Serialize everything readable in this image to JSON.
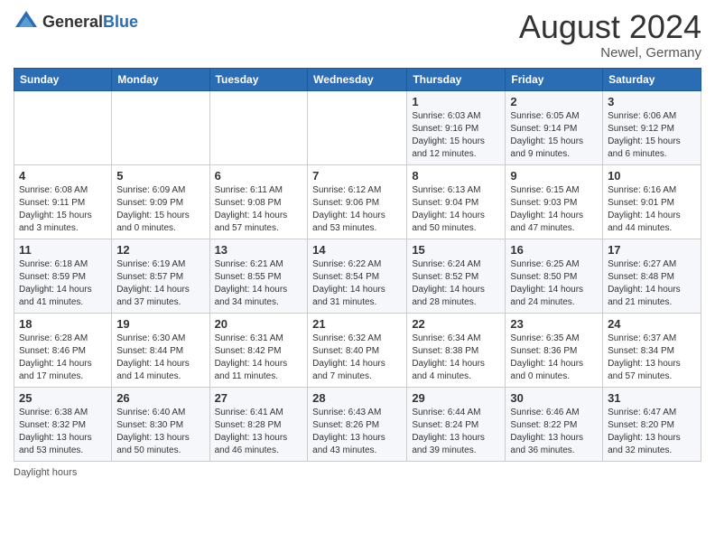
{
  "header": {
    "logo_general": "General",
    "logo_blue": "Blue",
    "month_year": "August 2024",
    "location": "Newel, Germany"
  },
  "days_of_week": [
    "Sunday",
    "Monday",
    "Tuesday",
    "Wednesday",
    "Thursday",
    "Friday",
    "Saturday"
  ],
  "footer": {
    "daylight_note": "Daylight hours"
  },
  "weeks": [
    [
      {
        "day": "",
        "info": ""
      },
      {
        "day": "",
        "info": ""
      },
      {
        "day": "",
        "info": ""
      },
      {
        "day": "",
        "info": ""
      },
      {
        "day": "1",
        "info": "Sunrise: 6:03 AM\nSunset: 9:16 PM\nDaylight: 15 hours\nand 12 minutes."
      },
      {
        "day": "2",
        "info": "Sunrise: 6:05 AM\nSunset: 9:14 PM\nDaylight: 15 hours\nand 9 minutes."
      },
      {
        "day": "3",
        "info": "Sunrise: 6:06 AM\nSunset: 9:12 PM\nDaylight: 15 hours\nand 6 minutes."
      }
    ],
    [
      {
        "day": "4",
        "info": "Sunrise: 6:08 AM\nSunset: 9:11 PM\nDaylight: 15 hours\nand 3 minutes."
      },
      {
        "day": "5",
        "info": "Sunrise: 6:09 AM\nSunset: 9:09 PM\nDaylight: 15 hours\nand 0 minutes."
      },
      {
        "day": "6",
        "info": "Sunrise: 6:11 AM\nSunset: 9:08 PM\nDaylight: 14 hours\nand 57 minutes."
      },
      {
        "day": "7",
        "info": "Sunrise: 6:12 AM\nSunset: 9:06 PM\nDaylight: 14 hours\nand 53 minutes."
      },
      {
        "day": "8",
        "info": "Sunrise: 6:13 AM\nSunset: 9:04 PM\nDaylight: 14 hours\nand 50 minutes."
      },
      {
        "day": "9",
        "info": "Sunrise: 6:15 AM\nSunset: 9:03 PM\nDaylight: 14 hours\nand 47 minutes."
      },
      {
        "day": "10",
        "info": "Sunrise: 6:16 AM\nSunset: 9:01 PM\nDaylight: 14 hours\nand 44 minutes."
      }
    ],
    [
      {
        "day": "11",
        "info": "Sunrise: 6:18 AM\nSunset: 8:59 PM\nDaylight: 14 hours\nand 41 minutes."
      },
      {
        "day": "12",
        "info": "Sunrise: 6:19 AM\nSunset: 8:57 PM\nDaylight: 14 hours\nand 37 minutes."
      },
      {
        "day": "13",
        "info": "Sunrise: 6:21 AM\nSunset: 8:55 PM\nDaylight: 14 hours\nand 34 minutes."
      },
      {
        "day": "14",
        "info": "Sunrise: 6:22 AM\nSunset: 8:54 PM\nDaylight: 14 hours\nand 31 minutes."
      },
      {
        "day": "15",
        "info": "Sunrise: 6:24 AM\nSunset: 8:52 PM\nDaylight: 14 hours\nand 28 minutes."
      },
      {
        "day": "16",
        "info": "Sunrise: 6:25 AM\nSunset: 8:50 PM\nDaylight: 14 hours\nand 24 minutes."
      },
      {
        "day": "17",
        "info": "Sunrise: 6:27 AM\nSunset: 8:48 PM\nDaylight: 14 hours\nand 21 minutes."
      }
    ],
    [
      {
        "day": "18",
        "info": "Sunrise: 6:28 AM\nSunset: 8:46 PM\nDaylight: 14 hours\nand 17 minutes."
      },
      {
        "day": "19",
        "info": "Sunrise: 6:30 AM\nSunset: 8:44 PM\nDaylight: 14 hours\nand 14 minutes."
      },
      {
        "day": "20",
        "info": "Sunrise: 6:31 AM\nSunset: 8:42 PM\nDaylight: 14 hours\nand 11 minutes."
      },
      {
        "day": "21",
        "info": "Sunrise: 6:32 AM\nSunset: 8:40 PM\nDaylight: 14 hours\nand 7 minutes."
      },
      {
        "day": "22",
        "info": "Sunrise: 6:34 AM\nSunset: 8:38 PM\nDaylight: 14 hours\nand 4 minutes."
      },
      {
        "day": "23",
        "info": "Sunrise: 6:35 AM\nSunset: 8:36 PM\nDaylight: 14 hours\nand 0 minutes."
      },
      {
        "day": "24",
        "info": "Sunrise: 6:37 AM\nSunset: 8:34 PM\nDaylight: 13 hours\nand 57 minutes."
      }
    ],
    [
      {
        "day": "25",
        "info": "Sunrise: 6:38 AM\nSunset: 8:32 PM\nDaylight: 13 hours\nand 53 minutes."
      },
      {
        "day": "26",
        "info": "Sunrise: 6:40 AM\nSunset: 8:30 PM\nDaylight: 13 hours\nand 50 minutes."
      },
      {
        "day": "27",
        "info": "Sunrise: 6:41 AM\nSunset: 8:28 PM\nDaylight: 13 hours\nand 46 minutes."
      },
      {
        "day": "28",
        "info": "Sunrise: 6:43 AM\nSunset: 8:26 PM\nDaylight: 13 hours\nand 43 minutes."
      },
      {
        "day": "29",
        "info": "Sunrise: 6:44 AM\nSunset: 8:24 PM\nDaylight: 13 hours\nand 39 minutes."
      },
      {
        "day": "30",
        "info": "Sunrise: 6:46 AM\nSunset: 8:22 PM\nDaylight: 13 hours\nand 36 minutes."
      },
      {
        "day": "31",
        "info": "Sunrise: 6:47 AM\nSunset: 8:20 PM\nDaylight: 13 hours\nand 32 minutes."
      }
    ]
  ]
}
